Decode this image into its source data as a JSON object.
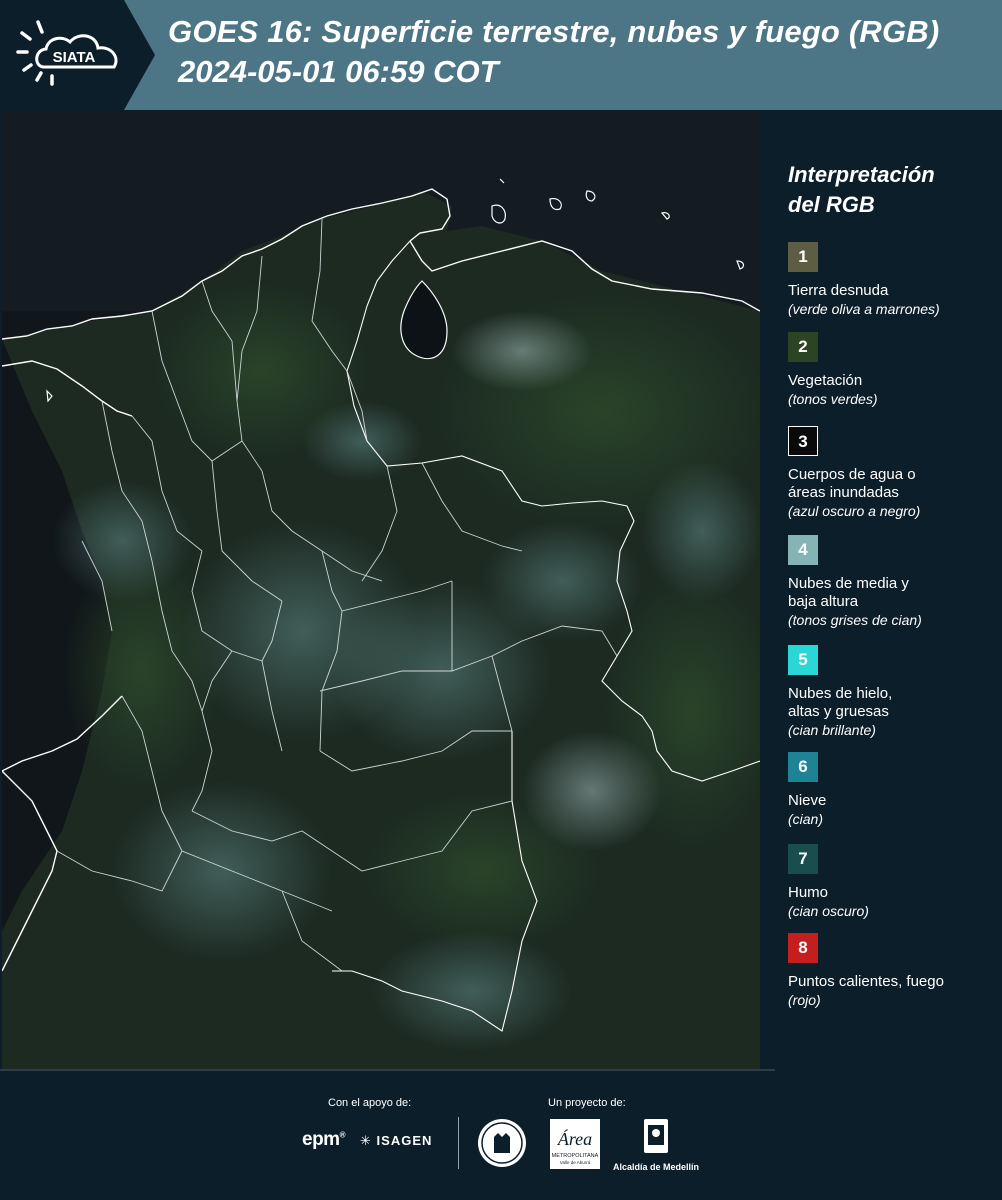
{
  "header": {
    "logo_text": "SIATA",
    "title_line1": "GOES 16: Superficie terrestre, nubes y fuego (RGB)",
    "title_line2": "2024-05-01 06:59 COT",
    "background_color": "#4c7585",
    "logo_panel_color": "#0d1e2b"
  },
  "legend": {
    "title_line1": "Interpretación",
    "title_line2": "del RGB",
    "items": [
      {
        "number": "1",
        "label": "Tierra desnuda",
        "note": "(verde oliva a marrones)",
        "color": "#5d5d43"
      },
      {
        "number": "2",
        "label": "Vegetación",
        "note": "(tonos verdes)",
        "color": "#2d4424"
      },
      {
        "number": "3",
        "label": "Cuerpos de agua o",
        "label2": "áreas inundadas",
        "note": "(azul oscuro a negro)",
        "color": "#0a0a0a"
      },
      {
        "number": "4",
        "label": "Nubes de media y",
        "label2": "baja altura",
        "note": "(tonos grises de cian)",
        "color": "#86b4b4"
      },
      {
        "number": "5",
        "label": "Nubes de hielo,",
        "label2": "altas y gruesas",
        "note": "(cian brillante)",
        "color": "#2ad6d6"
      },
      {
        "number": "6",
        "label": "Nieve",
        "note": "(cian)",
        "color": "#1f8396"
      },
      {
        "number": "7",
        "label": "Humo",
        "note": "(cian oscuro)",
        "color": "#1a4d4d"
      },
      {
        "number": "8",
        "label": "Puntos calientes, fuego",
        "note": "(rojo)",
        "color": "#c41e1e"
      }
    ]
  },
  "footer": {
    "support_label": "Con el apoyo de:",
    "project_label": "Un proyecto de:",
    "epm_text": "epm",
    "isagen_text": "ISAGEN",
    "amva_text": "Área",
    "amva_subtext": "METROPOLITANA",
    "amva_subtext2": "Valle de Aburrá",
    "alcaldia_text": "Alcaldía de Medellín"
  }
}
